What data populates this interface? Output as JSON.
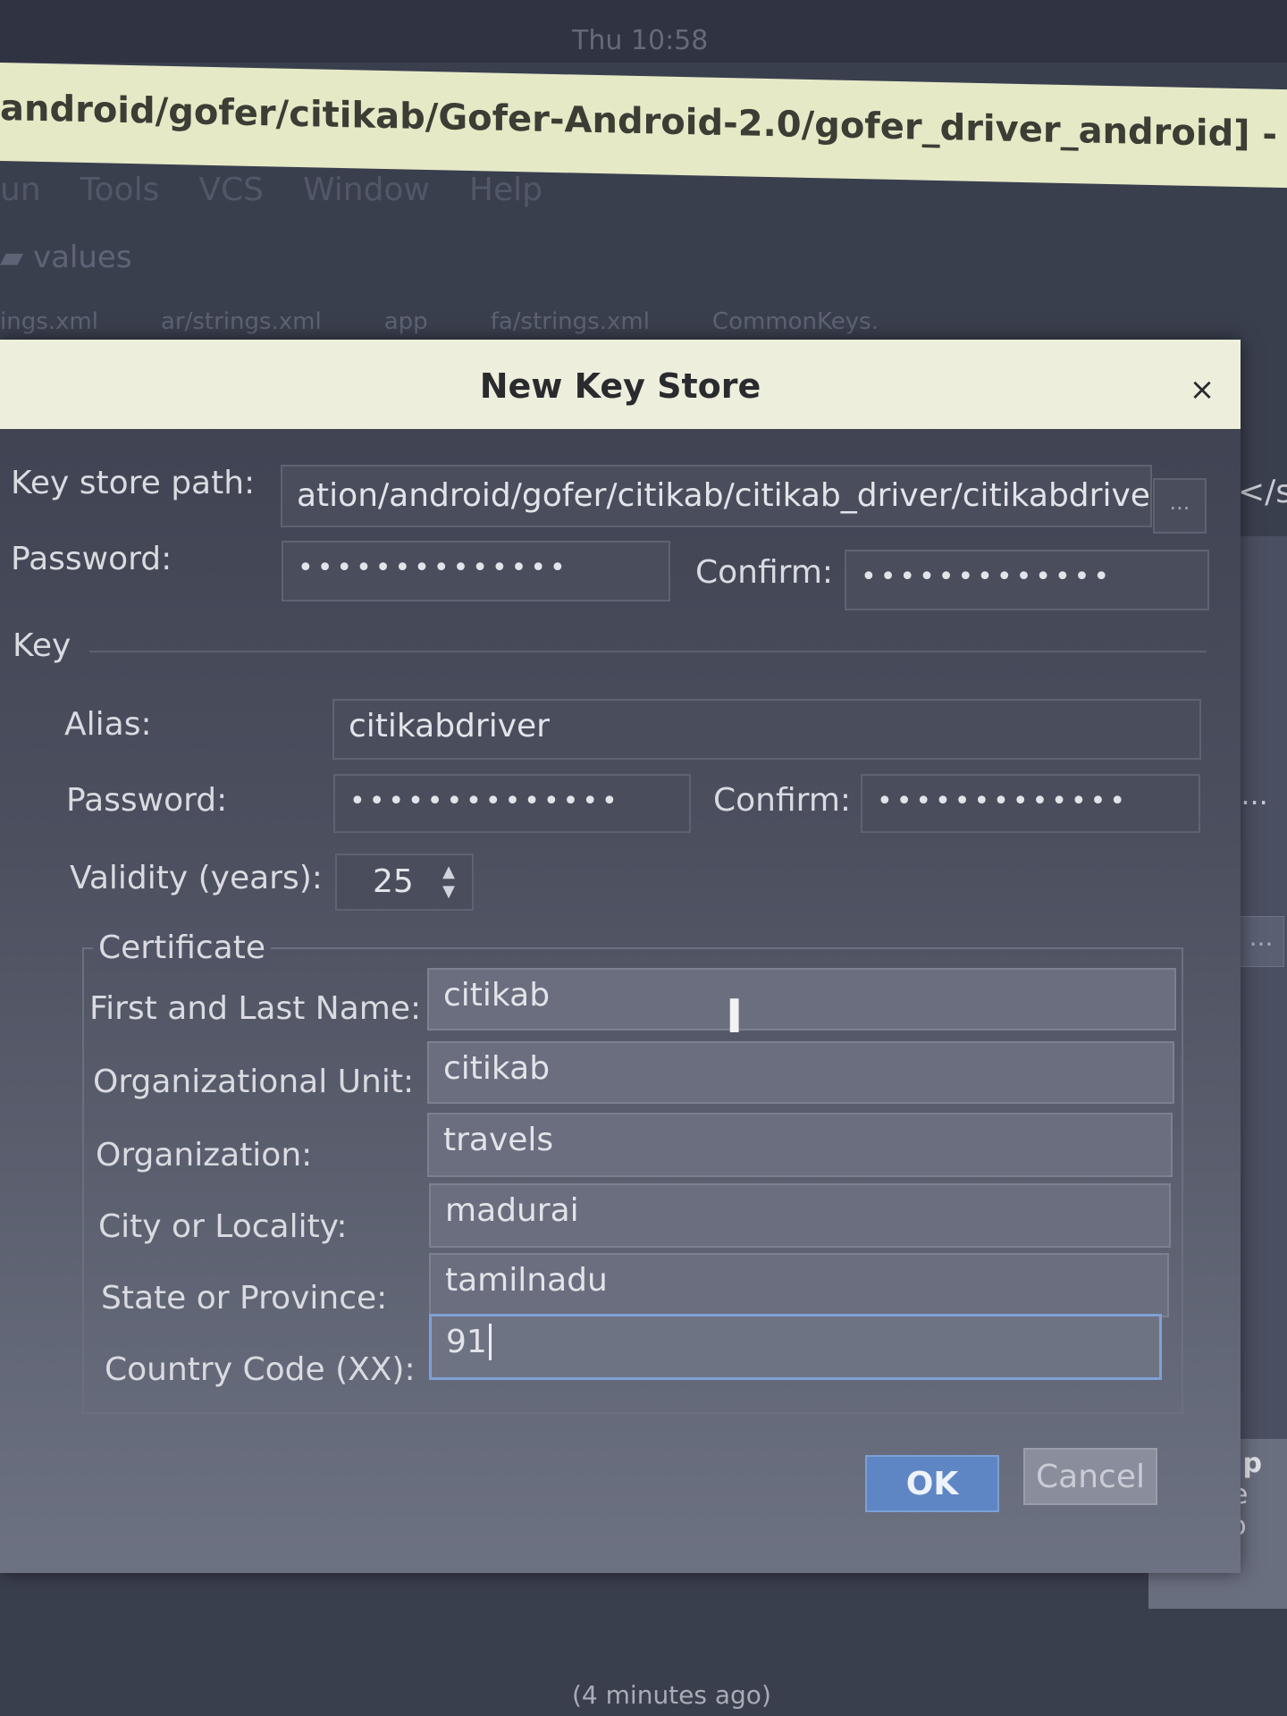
{
  "ide": {
    "clock": "Thu 10:58",
    "title": "android/gofer/citikab/Gofer-Android-2.0/gofer_driver_android] - .../app/src/mai",
    "menu": [
      "un",
      "Tools",
      "VCS",
      "Window",
      "Help"
    ],
    "breadcrumb": "values",
    "tabs": [
      "ings.xml",
      "ar/strings.xml",
      "app",
      "fa/strings.xml",
      "CommonKeys."
    ],
    "right_partial_path": "</s",
    "right_partial_btn": "g...",
    "right_partial_more": "...",
    "help_title": "Help",
    "help_lines": [
      "Please",
      "Studio"
    ],
    "status": "(4 minutes ago)"
  },
  "dialog": {
    "title": "New Key Store",
    "close_symbol": "×",
    "keystore_path_label": "Key store path:",
    "keystore_path_value": "ation/android/gofer/citikab/citikab_driver/citikabdriver.jks",
    "browse_label": "...",
    "password_label": "Password:",
    "password_value": "••••••••••••••",
    "confirm_label": "Confirm:",
    "confirm_value": "•••••••••••••",
    "key_section": "Key",
    "alias_label": "Alias:",
    "alias_value": "citikabdriver",
    "key_password_label": "Password:",
    "key_password_value": "••••••••••••••",
    "key_confirm_label": "Confirm:",
    "key_confirm_value": "•••••••••••••",
    "validity_label": "Validity (years):",
    "validity_value": "25",
    "certificate_section": "Certificate",
    "fields": [
      {
        "label": "First and Last Name:",
        "value": "citikab"
      },
      {
        "label": "Organizational Unit:",
        "value": "citikab"
      },
      {
        "label": "Organization:",
        "value": "travels"
      },
      {
        "label": "City or Locality:",
        "value": "madurai"
      },
      {
        "label": "State or Province:",
        "value": "tamilnadu"
      },
      {
        "label": "Country Code (XX):",
        "value": "91"
      }
    ],
    "ok_label": "OK",
    "cancel_label": "Cancel"
  },
  "colors": {
    "accent": "#5f86c4",
    "dialog_header": "#eeeedd",
    "ide_titlebar": "#e6e9c6"
  }
}
